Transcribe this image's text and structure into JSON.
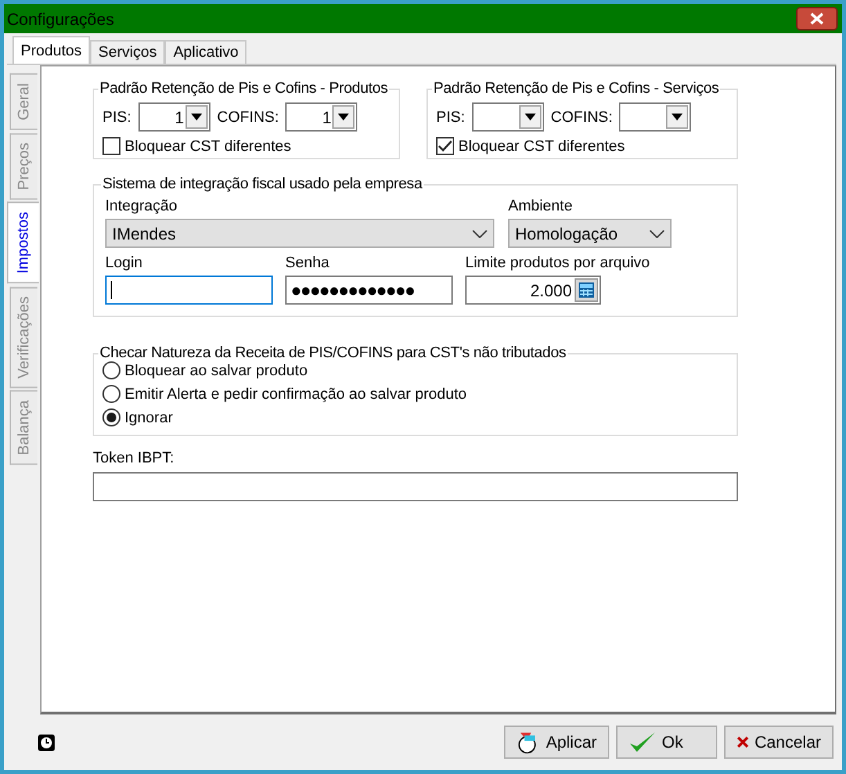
{
  "window": {
    "title": "Configurações"
  },
  "top_tabs": [
    {
      "label": "Produtos",
      "selected": true
    },
    {
      "label": "Serviços",
      "selected": false
    },
    {
      "label": "Aplicativo",
      "selected": false
    }
  ],
  "side_tabs": [
    {
      "label": "Geral",
      "selected": false
    },
    {
      "label": "Preços",
      "selected": false
    },
    {
      "label": "Impostos",
      "selected": true
    },
    {
      "label": "Verificações",
      "selected": false
    },
    {
      "label": "Balança",
      "selected": false
    }
  ],
  "retention_groups": [
    {
      "title": "Padrão Retenção de Pis e Cofins - Produtos",
      "pis_label": "PIS:",
      "pis_value": "1",
      "cofins_label": "COFINS:",
      "cofins_value": "1",
      "block_label": "Bloquear CST diferentes",
      "checked": false
    },
    {
      "title": "Padrão Retenção de Pis e Cofins - Serviços",
      "pis_label": "PIS:",
      "cofins_label": "COFINS:",
      "block_label": "Bloquear CST diferentes",
      "checked": true
    }
  ],
  "integration": {
    "title": "Sistema de integração fiscal usado pela empresa",
    "integration_label": "Integração",
    "integration_value": "IMendes",
    "environment_label": "Ambiente",
    "environment_value": "Homologação",
    "login_label": "Login",
    "password_label": "Senha",
    "password_value": "●●●●●●●●●●●●●",
    "limit_label": "Limite produtos por arquivo",
    "limit_value": "2.000"
  },
  "nature_check": {
    "title": "Checar Natureza da Receita de PIS/COFINS para CST's não tributados",
    "options": [
      {
        "label": "Bloquear ao salvar produto",
        "selected": false
      },
      {
        "label": "Emitir Alerta e pedir confirmação ao salvar produto",
        "selected": false
      },
      {
        "label": "Ignorar",
        "selected": true
      }
    ]
  },
  "token": {
    "label": "Token IBPT:"
  },
  "buttons": [
    {
      "kind": "apply",
      "label": "Aplicar"
    },
    {
      "kind": "ok",
      "label": "Ok"
    },
    {
      "kind": "cancel",
      "label": "Cancelar"
    }
  ]
}
